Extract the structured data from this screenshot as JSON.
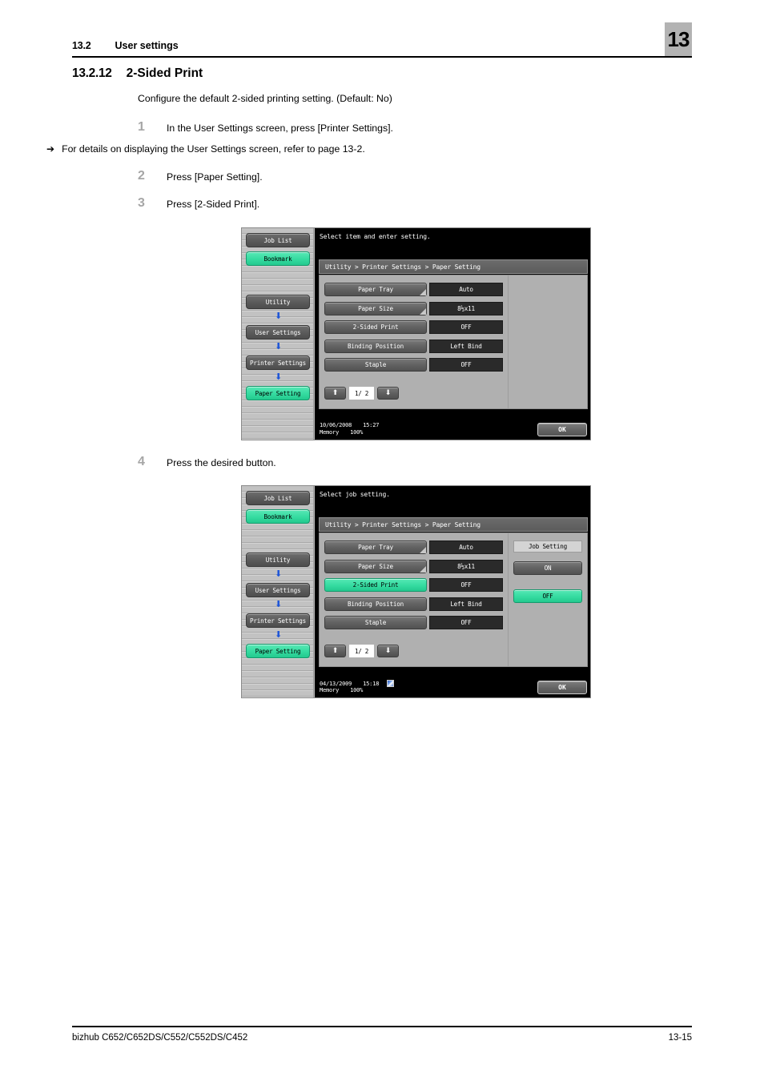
{
  "header": {
    "section_number": "13.2",
    "section_title": "User settings",
    "chapter_badge": "13"
  },
  "section": {
    "number": "13.2.12",
    "title": "2-Sided Print",
    "intro": "Configure the default 2-sided printing setting. (Default: No)"
  },
  "steps": [
    {
      "num": "1",
      "text": "In the User Settings screen, press [Printer Settings].",
      "substep": "For details on displaying the User Settings screen, refer to page 13-2.",
      "substep_arrow": "➔"
    },
    {
      "num": "2",
      "text": "Press [Paper Setting]."
    },
    {
      "num": "3",
      "text": "Press [2-Sided Print]."
    },
    {
      "num": "4",
      "text": "Press the desired button."
    }
  ],
  "screen1": {
    "prompt": "Select item and enter setting.",
    "breadcrumb": "Utility > Printer Settings > Paper Setting",
    "nav": [
      {
        "label": "Job List",
        "state": "normal"
      },
      {
        "label": "Bookmark",
        "state": "selected"
      },
      {
        "label": "Utility",
        "state": "normal"
      },
      {
        "label": "User Settings",
        "state": "normal"
      },
      {
        "label": "Printer Settings",
        "state": "normal"
      },
      {
        "label": "Paper Setting",
        "state": "selected"
      }
    ],
    "settings": [
      {
        "label": "Paper Tray",
        "value": "Auto",
        "submenu": true,
        "selected": false
      },
      {
        "label": "Paper Size",
        "value": "8½x11",
        "submenu": true,
        "selected": false
      },
      {
        "label": "2-Sided Print",
        "value": "OFF",
        "submenu": false,
        "selected": false
      },
      {
        "label": "Binding Position",
        "value": "Left Bind",
        "submenu": false,
        "selected": false
      },
      {
        "label": "Staple",
        "value": "OFF",
        "submenu": false,
        "selected": false
      }
    ],
    "pager": {
      "up": "⬆",
      "page": "1/ 2",
      "down": "⬇"
    },
    "status": {
      "date": "10/06/2008",
      "time": "15:27",
      "memory_label": "Memory",
      "memory_value": "100%",
      "has_icon": false
    },
    "ok_label": "OK",
    "job_panel": null
  },
  "screen2": {
    "prompt": "Select job setting.",
    "breadcrumb": "Utility > Printer Settings > Paper Setting",
    "nav": [
      {
        "label": "Job List",
        "state": "normal"
      },
      {
        "label": "Bookmark",
        "state": "selected"
      },
      {
        "label": "Utility",
        "state": "normal"
      },
      {
        "label": "User Settings",
        "state": "normal"
      },
      {
        "label": "Printer Settings",
        "state": "normal"
      },
      {
        "label": "Paper Setting",
        "state": "selected"
      }
    ],
    "settings": [
      {
        "label": "Paper Tray",
        "value": "Auto",
        "submenu": true,
        "selected": false
      },
      {
        "label": "Paper Size",
        "value": "8½x11",
        "submenu": true,
        "selected": false
      },
      {
        "label": "2-Sided Print",
        "value": "OFF",
        "submenu": false,
        "selected": true
      },
      {
        "label": "Binding Position",
        "value": "Left Bind",
        "submenu": false,
        "selected": false
      },
      {
        "label": "Staple",
        "value": "OFF",
        "submenu": false,
        "selected": false
      }
    ],
    "pager": {
      "up": "⬆",
      "page": "1/ 2",
      "down": "⬇"
    },
    "status": {
      "date": "04/13/2009",
      "time": "15:18",
      "memory_label": "Memory",
      "memory_value": "100%",
      "has_icon": true
    },
    "ok_label": "OK",
    "job_panel": {
      "title": "Job Setting",
      "on_label": "ON",
      "off_label": "OFF",
      "selected": "OFF"
    }
  },
  "footer": {
    "product": "bizhub C652/C652DS/C552/C552DS/C452",
    "page": "13-15"
  },
  "colors": {
    "accent_green": "#35dba0",
    "badge_gray": "#b3b3b3",
    "panel_gray": "#b0b0b0",
    "button_dark": "#606060",
    "value_dark": "#2a2a2a",
    "arrow_blue": "#1f56d8"
  }
}
